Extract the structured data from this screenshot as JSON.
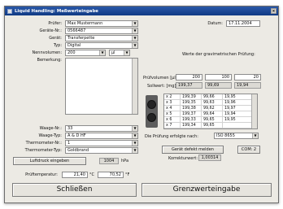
{
  "window": {
    "title": "Liquid Handling: Meßwerteingabe",
    "close": "×"
  },
  "form": {
    "prufer_label": "Prüfer:",
    "prufer_value": "Max Mustermann",
    "gerate_nr_label": "Geräte-Nr.:",
    "gerate_nr_value": "0566487",
    "gerat_label": "Gerät:",
    "gerat_value": "Transferpette",
    "typ_label": "Typ:",
    "typ_value": "Digital",
    "nennvolumen_label": "Nennvolumen:",
    "nennvolumen_value": "200",
    "nennvolumen_unit": "µl",
    "bemerkung_label": "Bemerkung:",
    "waage_nr_label": "Waage-Nr.:",
    "waage_nr_value": "33",
    "waage_typ_label": "Waage-Typ:",
    "waage_typ_value": "A & D HF",
    "thermo_nr_label": "Thermometer-Nr.:",
    "thermo_nr_value": "1",
    "thermo_typ_label": "Thermometer-Typ:",
    "thermo_typ_value": "Goldbrand",
    "luftdruck_button": "Luftdruck eingeben",
    "luftdruck_value": "1004",
    "luftdruck_unit": "hPa",
    "prueftemp_label": "Prüftemperatur:",
    "temp1_value": "21,40",
    "temp1_unit": "°C",
    "temp2_value": "70,52",
    "temp2_unit": "°F"
  },
  "right": {
    "datum_label": "Datum:",
    "datum_value": "17.11.2004",
    "werte_label": "Werte der gravimetrischen Prüfung:",
    "pruefvolumen_label": "Prüfvolumen [µl]:",
    "pv1": "200",
    "pv2": "100",
    "pv3": "20",
    "sollwert_label": "Sollwert: [mg]",
    "sw1": "199,37",
    "sw2": "99,69",
    "sw3": "19,94",
    "rows": [
      {
        "label": "x 2",
        "v1": "199,39",
        "v2": "99,66",
        "v3": "19,95"
      },
      {
        "label": "x 3",
        "v1": "199,35",
        "v2": "99,63",
        "v3": "19,96"
      },
      {
        "label": "x 4",
        "v1": "199,38",
        "v2": "99,62",
        "v3": "19,97"
      },
      {
        "label": "x 5",
        "v1": "199,37",
        "v2": "99,64",
        "v3": "19,94"
      },
      {
        "label": "x 6",
        "v1": "199,33",
        "v2": "99,65",
        "v3": "19,95"
      },
      {
        "label": "x 7",
        "v1": "199,34",
        "v2": "99,65",
        "v3": ""
      }
    ],
    "norm_label": "Die Prüfung erfolgte nach:",
    "norm_value": "ISO 8655",
    "geraet_defekt_button": "Gerät defekt melden",
    "com_button": "COM: 2",
    "korrekturwert_label": "Korrekturwert:",
    "korrekturwert_value": "1,00314"
  },
  "footer": {
    "close_button": "Schließen",
    "grenz_button": "Grenzwerteingabe"
  },
  "icons": {
    "close": "close-icon",
    "arrow": "chevron-down-icon",
    "thermo": "°C"
  }
}
